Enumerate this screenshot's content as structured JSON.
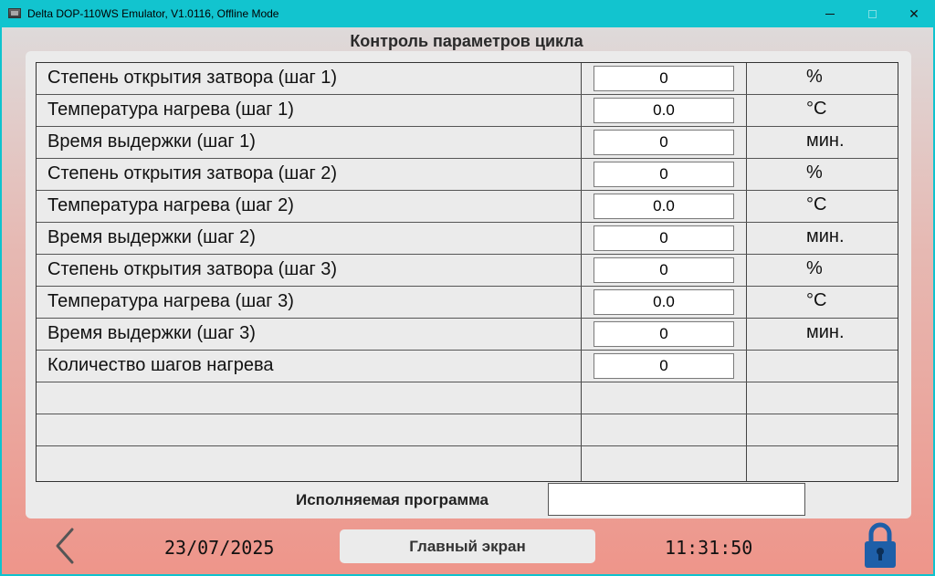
{
  "window": {
    "title": "Delta DOP-110WS Emulator, V1.0116, Offline Mode",
    "minimize_glyph": "",
    "maximize_glyph": "",
    "close_glyph": "✕"
  },
  "panel": {
    "title": "Контроль параметров цикла"
  },
  "rows": [
    {
      "label": "Степень открытия затвора (шаг 1)",
      "value": "0",
      "unit": "%"
    },
    {
      "label": "Температура нагрева (шаг 1)",
      "value": "0.0",
      "unit": "°C"
    },
    {
      "label": "Время выдержки (шаг 1)",
      "value": "0",
      "unit": "мин."
    },
    {
      "label": "Степень открытия затвора (шаг 2)",
      "value": "0",
      "unit": "%"
    },
    {
      "label": "Температура нагрева (шаг 2)",
      "value": "0.0",
      "unit": "°C"
    },
    {
      "label": "Время выдержки (шаг 2)",
      "value": "0",
      "unit": "мин."
    },
    {
      "label": "Степень открытия затвора (шаг 3)",
      "value": "0",
      "unit": "%"
    },
    {
      "label": "Температура нагрева (шаг 3)",
      "value": "0.0",
      "unit": "°C"
    },
    {
      "label": "Время выдержки (шаг 3)",
      "value": "0",
      "unit": "мин."
    },
    {
      "label": "Количество шагов нагрева",
      "value": "0",
      "unit": ""
    }
  ],
  "program": {
    "label": "Исполняемая программа",
    "value": ""
  },
  "footer": {
    "date": "23/07/2025",
    "home_label": "Главный экран",
    "time": "11:31:50"
  },
  "icons": {
    "back": "chevron-left-icon",
    "lock": "lock-icon",
    "lock_color": "#1E5FA8"
  }
}
